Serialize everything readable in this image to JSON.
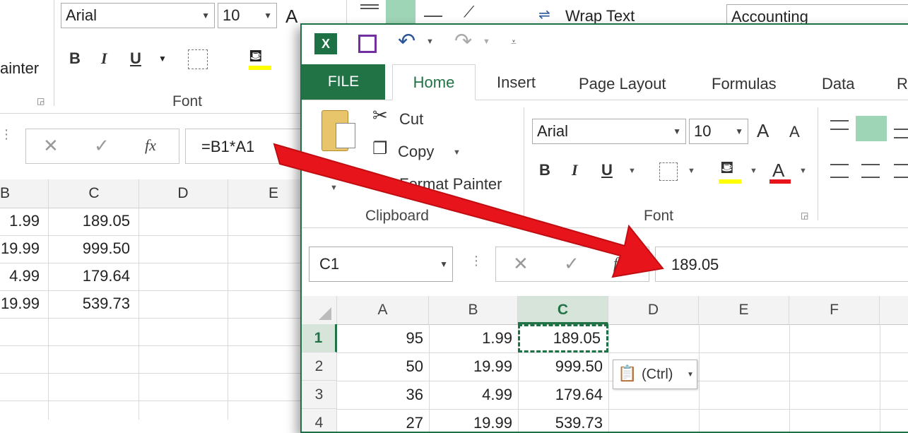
{
  "bg_window": {
    "font_name": "Arial",
    "font_size": "10",
    "painter_fragment": "ainter",
    "font_group_label": "Font",
    "wrap_text": "Wrap Text",
    "number_format": "Accounting",
    "formula": "=B1*A1",
    "col_headers": [
      "B",
      "C",
      "D",
      "E"
    ],
    "rows": [
      {
        "b": "1.99",
        "c": "189.05"
      },
      {
        "b": "19.99",
        "c": "999.50"
      },
      {
        "b": "4.99",
        "c": "179.64"
      },
      {
        "b": "19.99",
        "c": "539.73"
      }
    ]
  },
  "front_window": {
    "tabs": [
      "FILE",
      "Home",
      "Insert",
      "Page Layout",
      "Formulas",
      "Data",
      "R"
    ],
    "clipboard": {
      "cut": "Cut",
      "copy": "Copy",
      "format_painter": "Format Painter",
      "label": "Clipboard"
    },
    "font": {
      "name": "Arial",
      "size": "10",
      "label": "Font",
      "bold": "B",
      "italic": "I",
      "underline": "U"
    },
    "name_box": "C1",
    "formula_value": "189.05",
    "col_headers": [
      "A",
      "B",
      "C",
      "D",
      "E",
      "F"
    ],
    "rows": [
      {
        "num": "1",
        "a": "95",
        "b": "1.99",
        "c": "189.05"
      },
      {
        "num": "2",
        "a": "50",
        "b": "19.99",
        "c": "999.50"
      },
      {
        "num": "3",
        "a": "36",
        "b": "4.99",
        "c": "179.64"
      },
      {
        "num": "4",
        "a": "27",
        "b": "19.99",
        "c": "539.73"
      }
    ],
    "paste_options": "(Ctrl)"
  },
  "colors": {
    "excel_green": "#217346",
    "selection_green": "#1e7145",
    "arrow_red": "#e8141b",
    "highlight_yellow": "#ffff00"
  }
}
